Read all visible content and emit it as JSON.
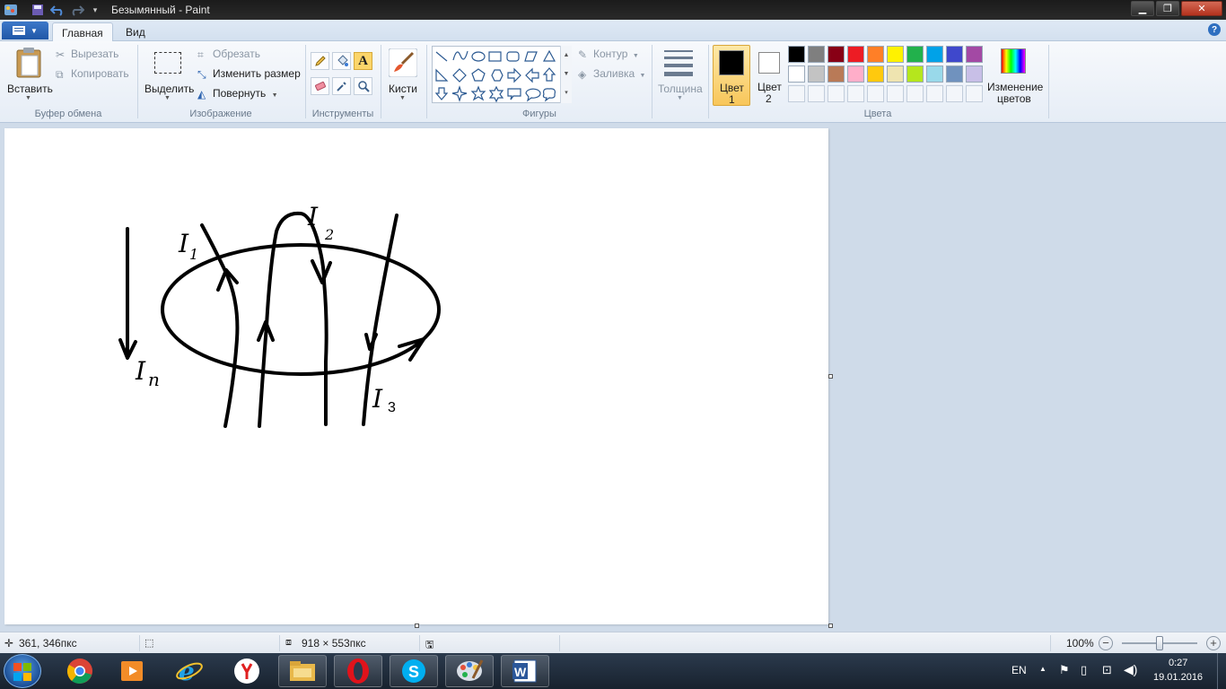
{
  "window": {
    "title": "Безымянный - Paint"
  },
  "tabs": {
    "home": "Главная",
    "view": "Вид"
  },
  "clipboard": {
    "paste": "Вставить",
    "cut": "Вырезать",
    "copy": "Копировать",
    "group": "Буфер обмена"
  },
  "image": {
    "select": "Выделить",
    "crop": "Обрезать",
    "resize": "Изменить размер",
    "rotate": "Повернуть",
    "group": "Изображение"
  },
  "tools": {
    "group": "Инструменты",
    "text_glyph": "A"
  },
  "brushes": {
    "label": "Кисти"
  },
  "shapes": {
    "outline": "Контур",
    "fill": "Заливка",
    "group": "Фигуры"
  },
  "size": {
    "label": "Толщина"
  },
  "colors": {
    "color1_line1": "Цвет",
    "color1_line2": "1",
    "color2_line1": "Цвет",
    "color2_line2": "2",
    "edit_line1": "Изменение",
    "edit_line2": "цветов",
    "group": "Цвета",
    "color1_value": "#000000",
    "color2_value": "#ffffff",
    "palette_row1": [
      "#000000",
      "#7f7f7f",
      "#880015",
      "#ed1c24",
      "#ff7f27",
      "#fff200",
      "#22b14c",
      "#00a2e8",
      "#3f48cc",
      "#a349a4"
    ],
    "palette_row2": [
      "#ffffff",
      "#c3c3c3",
      "#b97a57",
      "#ffaec9",
      "#ffc90e",
      "#efe4b0",
      "#b5e61d",
      "#99d9ea",
      "#7092be",
      "#c8bfe7"
    ]
  },
  "canvas_labels": {
    "i_n": "I",
    "i_n_sub": "n",
    "i1": "I",
    "i1_sub": "1",
    "i2": "I",
    "i2_sub": "2",
    "i3": "I",
    "i3_sub": "3"
  },
  "status": {
    "cursor": "361, 346пкс",
    "size": "918 × 553пкс",
    "zoom": "100%"
  },
  "tray": {
    "lang": "EN",
    "time": "0:27",
    "date": "19.01.2016"
  }
}
